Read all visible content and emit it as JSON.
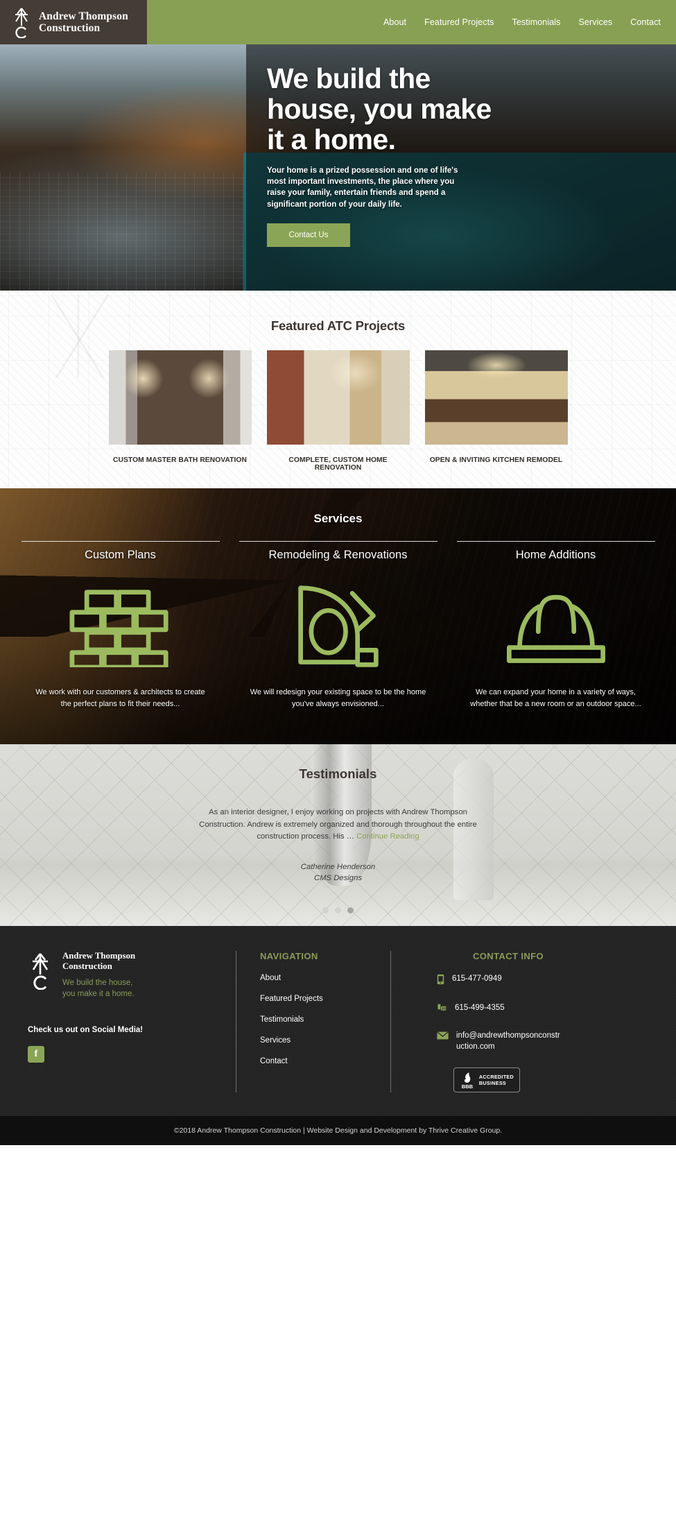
{
  "brand": {
    "name_line1": "Andrew Thompson",
    "name_line2": "Construction",
    "tagline_line1": "We build the house,",
    "tagline_line2": "you make it a home."
  },
  "colors": {
    "green": "#8ba556",
    "header_brown": "#443c36",
    "footer_dark": "#242424",
    "copyright_bar": "#100f10",
    "accent_text_green": "#8a9a5b"
  },
  "nav": {
    "items": [
      {
        "label": "About"
      },
      {
        "label": "Featured Projects"
      },
      {
        "label": "Testimonials"
      },
      {
        "label": "Services"
      },
      {
        "label": "Contact"
      }
    ]
  },
  "hero": {
    "title": "We build the house, you make it a home.",
    "paragraph": "Your home is a prized possession and one of life's most important investments, the place where you raise your family, entertain friends and spend a significant portion of your daily life.",
    "button_label": "Contact Us"
  },
  "featured": {
    "title": "Featured ATC Projects",
    "projects": [
      {
        "caption": "CUSTOM MASTER BATH RENOVATION"
      },
      {
        "caption": "COMPLETE, CUSTOM HOME RENOVATION"
      },
      {
        "caption": "OPEN & INVITING KITCHEN REMODEL"
      }
    ]
  },
  "services": {
    "title": "Services",
    "items": [
      {
        "name": "Custom Plans",
        "icon": "brick-wall-icon",
        "description": "We work with our customers & architects to create the perfect plans to fit their needs..."
      },
      {
        "name": "Remodeling & Renovations",
        "icon": "tape-measure-icon",
        "description": "We will redesign your existing space to be the home you've always envisioned..."
      },
      {
        "name": "Home Additions",
        "icon": "hard-hat-icon",
        "description": "We can expand your home in a variety of ways, whether that be a new room or an outdoor space..."
      }
    ]
  },
  "testimonials": {
    "title": "Testimonials",
    "quote": "As an interior designer, I enjoy working on projects with Andrew Thompson Construction.  Andrew is extremely organized and thorough throughout the entire construction process.  His …",
    "continue_label": "Continue Reading",
    "author_name": "Catherine Henderson",
    "author_company": "CMS Designs",
    "slide_count": 3,
    "active_slide": 3
  },
  "footer": {
    "social_label": "Check us out on Social Media!",
    "facebook_glyph": "f",
    "nav_heading": "NAVIGATION",
    "nav_links": [
      {
        "label": "About"
      },
      {
        "label": "Featured Projects"
      },
      {
        "label": "Testimonials"
      },
      {
        "label": "Services"
      },
      {
        "label": "Contact"
      }
    ],
    "contact_heading": "CONTACT INFO",
    "contacts": [
      {
        "icon": "mobile-phone-icon",
        "value": "615-477-0949"
      },
      {
        "icon": "desk-phone-icon",
        "value": "615-499-4355"
      },
      {
        "icon": "envelope-icon",
        "value": "info@andrewthompsonconstruction.com"
      }
    ],
    "bbb": {
      "mark": "BBB",
      "line1": "ACCREDITED",
      "line2": "BUSINESS"
    },
    "copyright": "©2018 Andrew Thompson Construction | Website Design and Development by Thrive Creative Group."
  }
}
